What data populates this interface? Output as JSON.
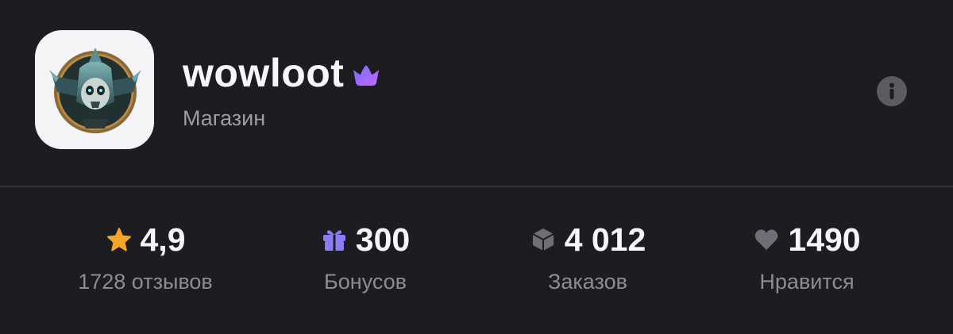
{
  "shop": {
    "name": "wowloot",
    "type": "Магазин",
    "badge_icon": "crown-icon",
    "info_icon": "info-icon",
    "avatar_icon": "skull-shield-emblem"
  },
  "colors": {
    "background": "#1d1d21",
    "star": "#f5a623",
    "gift": "#8b7cf6",
    "box": "#6e6e76",
    "heart": "#6e6e76",
    "crown_start": "#7b6cff",
    "crown_end": "#c46bff"
  },
  "stats": [
    {
      "icon": "star-icon",
      "value": "4,9",
      "label": "1728 отзывов"
    },
    {
      "icon": "gift-icon",
      "value": "300",
      "label": "Бонусов"
    },
    {
      "icon": "box-icon",
      "value": "4 012",
      "label": "Заказов"
    },
    {
      "icon": "heart-icon",
      "value": "1490",
      "label": "Нравится"
    }
  ]
}
